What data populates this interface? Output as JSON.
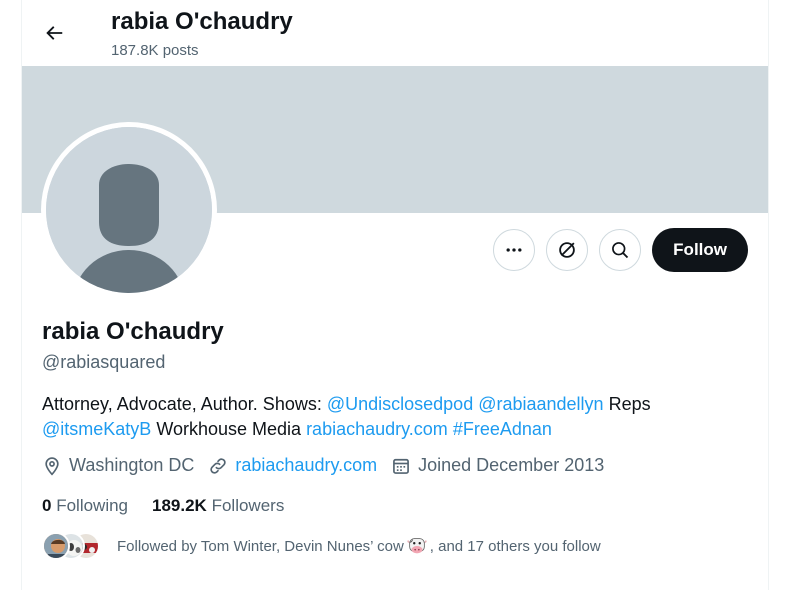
{
  "header": {
    "name": "rabia O'chaudry",
    "posts": "187.8K posts"
  },
  "profile": {
    "name": "rabia O'chaudry",
    "handle": "@rabiasquared",
    "follow_label": "Follow",
    "bio": {
      "text1": "Attorney, Advocate, Author. Shows: ",
      "mention1": "@Undisclosedpod",
      "mention2": "@rabiaandellyn",
      "text2": " Reps ",
      "mention3": "@itsmeKatyB",
      "text3": " Workhouse Media ",
      "link": "rabiachaudry.com",
      "hashtag": "#FreeAdnan"
    },
    "location": "Washington DC",
    "website": "rabiachaudry.com",
    "joined": "Joined December 2013",
    "following_count": "0",
    "following_label": "Following",
    "followers_count": "189.2K",
    "followers_label": "Followers",
    "followed_by_prefix": "Followed by Tom Winter, Devin Nunes’ cow",
    "followed_by_suffix": ", and 17 others you follow"
  },
  "colors": {
    "accent": "#1d9bf0",
    "text": "#0f1419",
    "secondary": "#536471",
    "banner": "#cfd9de",
    "follow_button": "#0f1419"
  },
  "icons": [
    "back-arrow-icon",
    "more-icon",
    "grok-icon",
    "search-icon",
    "location-icon",
    "link-icon",
    "calendar-icon",
    "cow-emoji-icon"
  ]
}
